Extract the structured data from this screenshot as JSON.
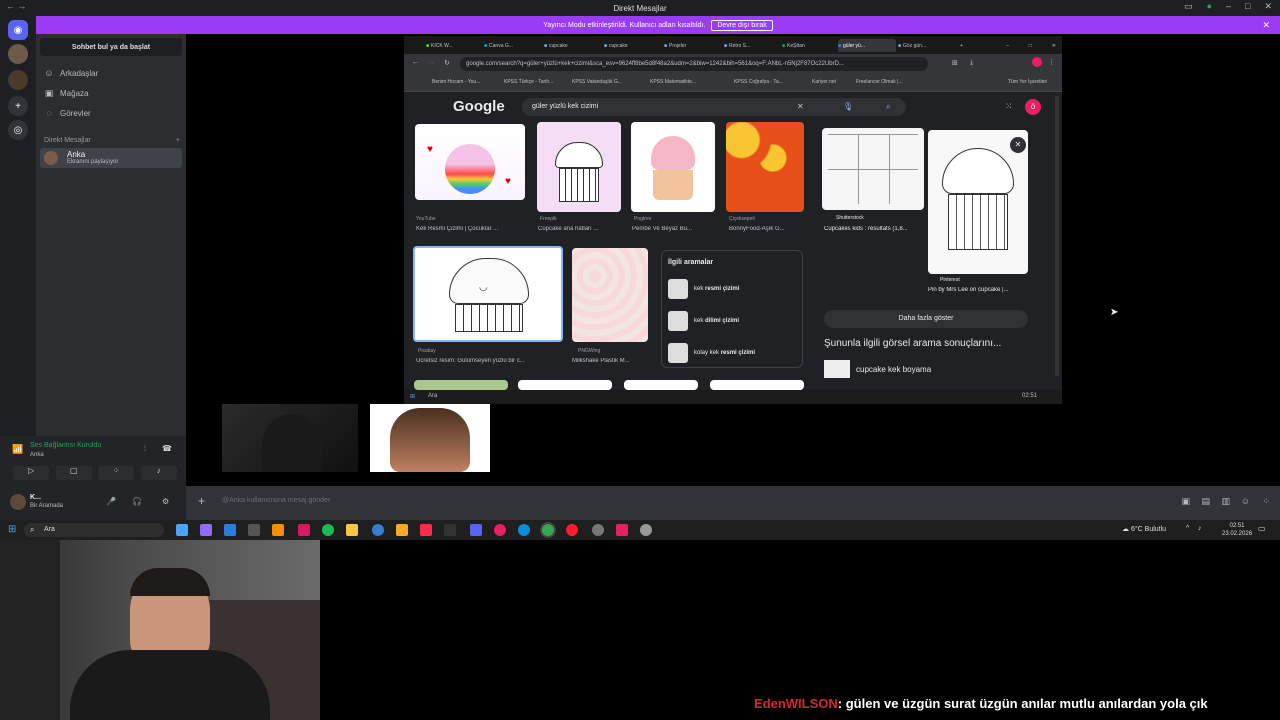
{
  "window": {
    "title": "Direkt Mesajlar"
  },
  "banner": {
    "text": "Yayıncı Modu etkinleştirildi. Kullanıcı adları kısaltıldı.",
    "button": "Devre dışı bırak"
  },
  "sidebar": {
    "search": "Sohbet bul ya da başlat",
    "nav": [
      {
        "label": "Arkadaşlar",
        "icon": "friends-icon"
      },
      {
        "label": "Mağaza",
        "icon": "shop-icon"
      },
      {
        "label": "Görevler",
        "icon": "quests-icon"
      }
    ],
    "dm_header": "Direkt Mesajlar",
    "dm": {
      "name": "Anka",
      "status": "Ekranını paylaşıyor"
    }
  },
  "voice": {
    "status": "Ses Bağlantısı Kuruldu",
    "channel": "Anka"
  },
  "user": {
    "name": "K...",
    "status": "Bir Aramada"
  },
  "message": {
    "placeholder": "@Anka kullanıcısına mesaj gönder"
  },
  "chrome": {
    "tabs": [
      "KICK W...",
      "Canva G...",
      "cupcake",
      "cupcake",
      "Projeler",
      "Retro S...",
      "KeŞttan",
      "güler yü...",
      "Göz gün..."
    ],
    "url": "google.com/search?q=güler+yüzlü+kek+cizimi&sca_esv=9624ff8be5d8f48a2&udm=2&biw=1242&bih=561&oq=F:ANbL-n5Nj2F87Oc22UbrD...",
    "bookmarks": [
      "Benim Hocam - You...",
      "KPSS Türkçe - Tarih...",
      "KPSS Vatandaşlık G...",
      "KPSS Matematikte...",
      "KPSS Coğrafya - Ta...",
      "Kariyer.net",
      "Freelancer Olmak |...",
      "Tüm Yer İşaretleri"
    ]
  },
  "google": {
    "logo": "Google",
    "query": "güler yüzlü kek cizimi",
    "avatar": "ö",
    "results_row1": [
      {
        "source": "YouTube",
        "caption": "Kek Resmi Çizimi | Çocuklar ..."
      },
      {
        "source": "Freepik",
        "caption": "Cupcake ana hatları ..."
      },
      {
        "source": "Pngtree",
        "caption": "Pembe Ve Beyaz Bu..."
      },
      {
        "source": "Çiçeksepeti",
        "caption": "BonnyFood-Aşık G..."
      }
    ],
    "results_row2": [
      {
        "source": "Pixabay",
        "caption": "Ücretsiz resim: Gülümseyen yüzlü bir c..."
      },
      {
        "source": "PNGWing",
        "caption": "Milkshake Plastik M..."
      }
    ],
    "related": {
      "title": "İlgili aramalar",
      "items": [
        {
          "prefix": "kek",
          "bold": "resmi çizimi"
        },
        {
          "prefix": "kek",
          "bold": "dilimi çizimi"
        },
        {
          "prefix": "kolay kek",
          "bold": "resmi çizimi"
        }
      ]
    },
    "panel": {
      "result1_source": "Shutterstock",
      "result1_caption": "Cupcakes kids : résultats (1,8...",
      "result2_source": "Pinterest",
      "result2_caption": "Pin by Mrs Lee on cupcake |...",
      "more_button": "Daha fazla göster",
      "similar_heading": "Şununla ilgili görsel arama sonuçlarını...",
      "similar_item": "cupcake kek boyama"
    }
  },
  "inner_taskbar": {
    "search": "Ara",
    "time": "02:51"
  },
  "taskbar": {
    "search": "Ara",
    "weather": "6°C Bulutlu",
    "time": "02:51",
    "date": "23.02.2026"
  },
  "chat": {
    "user": "EdenWILSON",
    "message": ": gülen ve üzgün surat üzgün anılar mutlu anılardan yola çık"
  }
}
